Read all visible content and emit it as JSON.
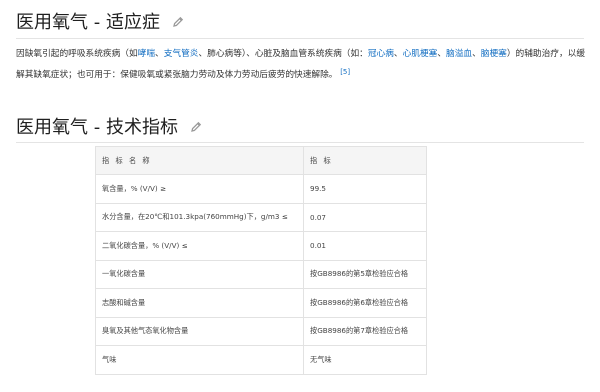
{
  "section1": {
    "title": "医用氧气 - 适应症",
    "edit_icon": "pencil-icon",
    "paragraph": {
      "t1": "因缺氧引起的呼吸系统疾病（如",
      "l1": "哮喘",
      "t2": "、",
      "l2": "支气管炎",
      "t3": "、肺心病等）、心脏及脑血管系统疾病（如：",
      "l3": "冠心病",
      "t4": "、",
      "l4": "心肌梗塞",
      "t5": "、",
      "l5": "脑溢血",
      "t6": "、",
      "l6": "脑梗塞",
      "t7": "）的辅助治疗，以缓解其缺氧症状；也可用于：保健吸氧或紧张脑力劳动及体力劳动后疲劳的快速解除。",
      "ref": "[5]"
    }
  },
  "section2": {
    "title": "医用氧气 - 技术指标",
    "edit_icon": "pencil-icon",
    "table": {
      "headers": [
        "指 标 名 称",
        "指 标"
      ],
      "rows": [
        [
          "氧含量，% (V/V) ≥",
          "99.5"
        ],
        [
          "水分含量，在20℃和101.3kpa(760mmHg)下，g/m3 ≤",
          "0.07"
        ],
        [
          "二氧化碳含量，% (V/V) ≤",
          "0.01"
        ],
        [
          "一氧化碳含量",
          "按GB8986的第5章检验应合格"
        ],
        [
          "志酸和碱含量",
          "按GB8986的第6章检验应合格"
        ],
        [
          "臭氧及其他气态氧化物含量",
          "按GB8986的第7章检验应合格"
        ],
        [
          "气味",
          "无气味"
        ]
      ]
    }
  }
}
